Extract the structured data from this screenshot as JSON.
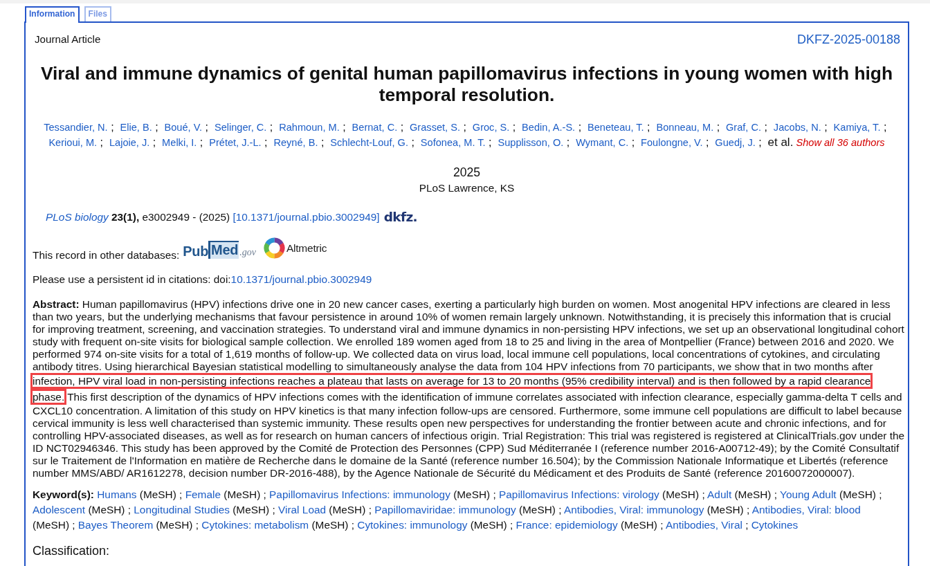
{
  "tabs": [
    {
      "label": "Information",
      "selected": true
    },
    {
      "label": "Files",
      "selected": false
    }
  ],
  "record": {
    "type": "Journal Article",
    "report_number": "DKFZ-2025-00188",
    "title": "Viral and immune dynamics of genital human papillomavirus infections in young women with high temporal resolution.",
    "authors": {
      "names": [
        "Tessandier, N.",
        "Elie, B.",
        "Boué, V.",
        "Selinger, C.",
        "Rahmoun, M.",
        "Bernat, C.",
        "Grasset, S.",
        "Groc, S.",
        "Bedin, A.-S.",
        "Beneteau, T.",
        "Bonneau, M.",
        "Graf, C.",
        "Jacobs, N.",
        "Kamiya, T.",
        "Kerioui, M.",
        "Lajoie, J.",
        "Melki, I.",
        "Prétet, J.-L.",
        "Reyné, B.",
        "Schlecht-Louf, G.",
        "Sofonea, M. T.",
        "Supplisson, O.",
        "Wymant, C.",
        "Foulongne, V.",
        "Guedj, J."
      ],
      "separator": ";",
      "et_al": "et al.",
      "show_all": "Show all 36 authors"
    },
    "year": "2025",
    "publisher": "PLoS Lawrence, KS",
    "citation": {
      "journal": "PLoS biology",
      "volume": "23(1),",
      "details": "e3002949 - (2025)",
      "doi_link": "[10.1371/journal.pbio.3002949]",
      "logo": "dkfz."
    },
    "other_databases": {
      "label": "This record in other databases:",
      "links": [
        {
          "kind": "pubmed",
          "parts": [
            "Pub",
            "Med",
            ".gov"
          ]
        },
        {
          "kind": "altmetric",
          "label": "Altmetric"
        }
      ]
    },
    "persistent_id": {
      "label": "Please use a persistent id in citations: doi:",
      "doi": "10.1371/journal.pbio.3002949"
    },
    "abstract": [
      {
        "text": "**Abstract:** Human papillomavirus (HPV) infections drive one in 20 new cancer cases, exerting a particularly high burden on women. Most anogenital HPV infections are cleared in less than two years, but the underlying mechanisms that favour persistence in around 10% of women remain largely unknown. Notwithstanding, it is precisely this information that is crucial for improving treatment, screening, and vaccination strategies. To understand viral and immune dynamics in non-persisting HPV infections, we set up an observational longitudinal cohort study with frequent on-site visits for biological sample collection. We enrolled 189 women aged from 18 to 25 and living in the area of Montpellier (France) between 2016 and 2020. We performed 974 on-site visits for a total of 1,619 months of follow-up. We collected data on virus load, local immune cell populations, local concentrations of cytokines, and circulating antibody titres. Using hierarchical Bayesian statistical modelling to simultaneously analyse the data from 104 HPV infections from 70 participants, we show that in two months after",
        "highlighted": false
      },
      {
        "text": "infection, HPV viral load in non-persisting infections reaches a plateau that lasts on average for 13 to 20 months (95% credibility interval) and is then followed by a rapid clearance phase.",
        "highlighted": true
      },
      {
        "text": "This first description of the dynamics of HPV infections comes with the identification of immune correlates associated with infection clearance, especially gamma-delta T cells and CXCL10 concentration. A limitation of this study on HPV kinetics is that many infection follow-ups are censored. Furthermore, some immune cell populations are difficult to label because cervical immunity is less well characterised than systemic immunity. These results open new perspectives for understanding the frontier between acute and chronic infections, and for controlling HPV-associated diseases, as well as for research on human cancers of infectious origin. Trial Registration: This trial was registered is registered at ClinicalTrials.gov under the ID NCT02946346. This study has been approved by the Comité de Protection des Personnes (CPP) Sud Méditerranée I (reference number 2016-A00712-49); by the Comité Consultatif sur le Traitement de l'Information en matière de Recherche dans le domaine de la Santé (reference number 16.504); by the Commission Nationale Informatique et Libertés (reference number MMS/ABD/ AR1612278, decision number DR-2016-488), by the Agence Nationale de Sécurité du Médicament et des Produits de Santé (reference 20160072000007).",
        "highlighted": false
      }
    ],
    "keywords": {
      "label": "Keyword(s):",
      "separator": ";",
      "items": [
        {
          "term": "Humans",
          "source": "(MeSH)"
        },
        {
          "term": "Female",
          "source": "(MeSH)"
        },
        {
          "term": "Papillomavirus Infections: immunology",
          "source": "(MeSH)"
        },
        {
          "term": "Papillomavirus Infections: virology",
          "source": "(MeSH)"
        },
        {
          "term": "Adult",
          "source": "(MeSH)"
        },
        {
          "term": "Young Adult",
          "source": "(MeSH)"
        },
        {
          "term": "Adolescent",
          "source": "(MeSH)"
        },
        {
          "term": "Longitudinal Studies",
          "source": "(MeSH)"
        },
        {
          "term": "Viral Load",
          "source": "(MeSH)"
        },
        {
          "term": "Papillomaviridae: immunology",
          "source": "(MeSH)"
        },
        {
          "term": "Antibodies, Viral: immunology",
          "source": "(MeSH)"
        },
        {
          "term": "Antibodies, Viral: blood",
          "source": "(MeSH)"
        },
        {
          "term": "Bayes Theorem",
          "source": "(MeSH)"
        },
        {
          "term": "Cytokines: metabolism",
          "source": "(MeSH)"
        },
        {
          "term": "Cytokines: immunology",
          "source": "(MeSH)"
        },
        {
          "term": "France: epidemiology",
          "source": "(MeSH)"
        },
        {
          "term": "Antibodies, Viral"
        },
        {
          "term": "Cytokines"
        }
      ]
    },
    "classification": {
      "heading": "Classification:"
    }
  }
}
